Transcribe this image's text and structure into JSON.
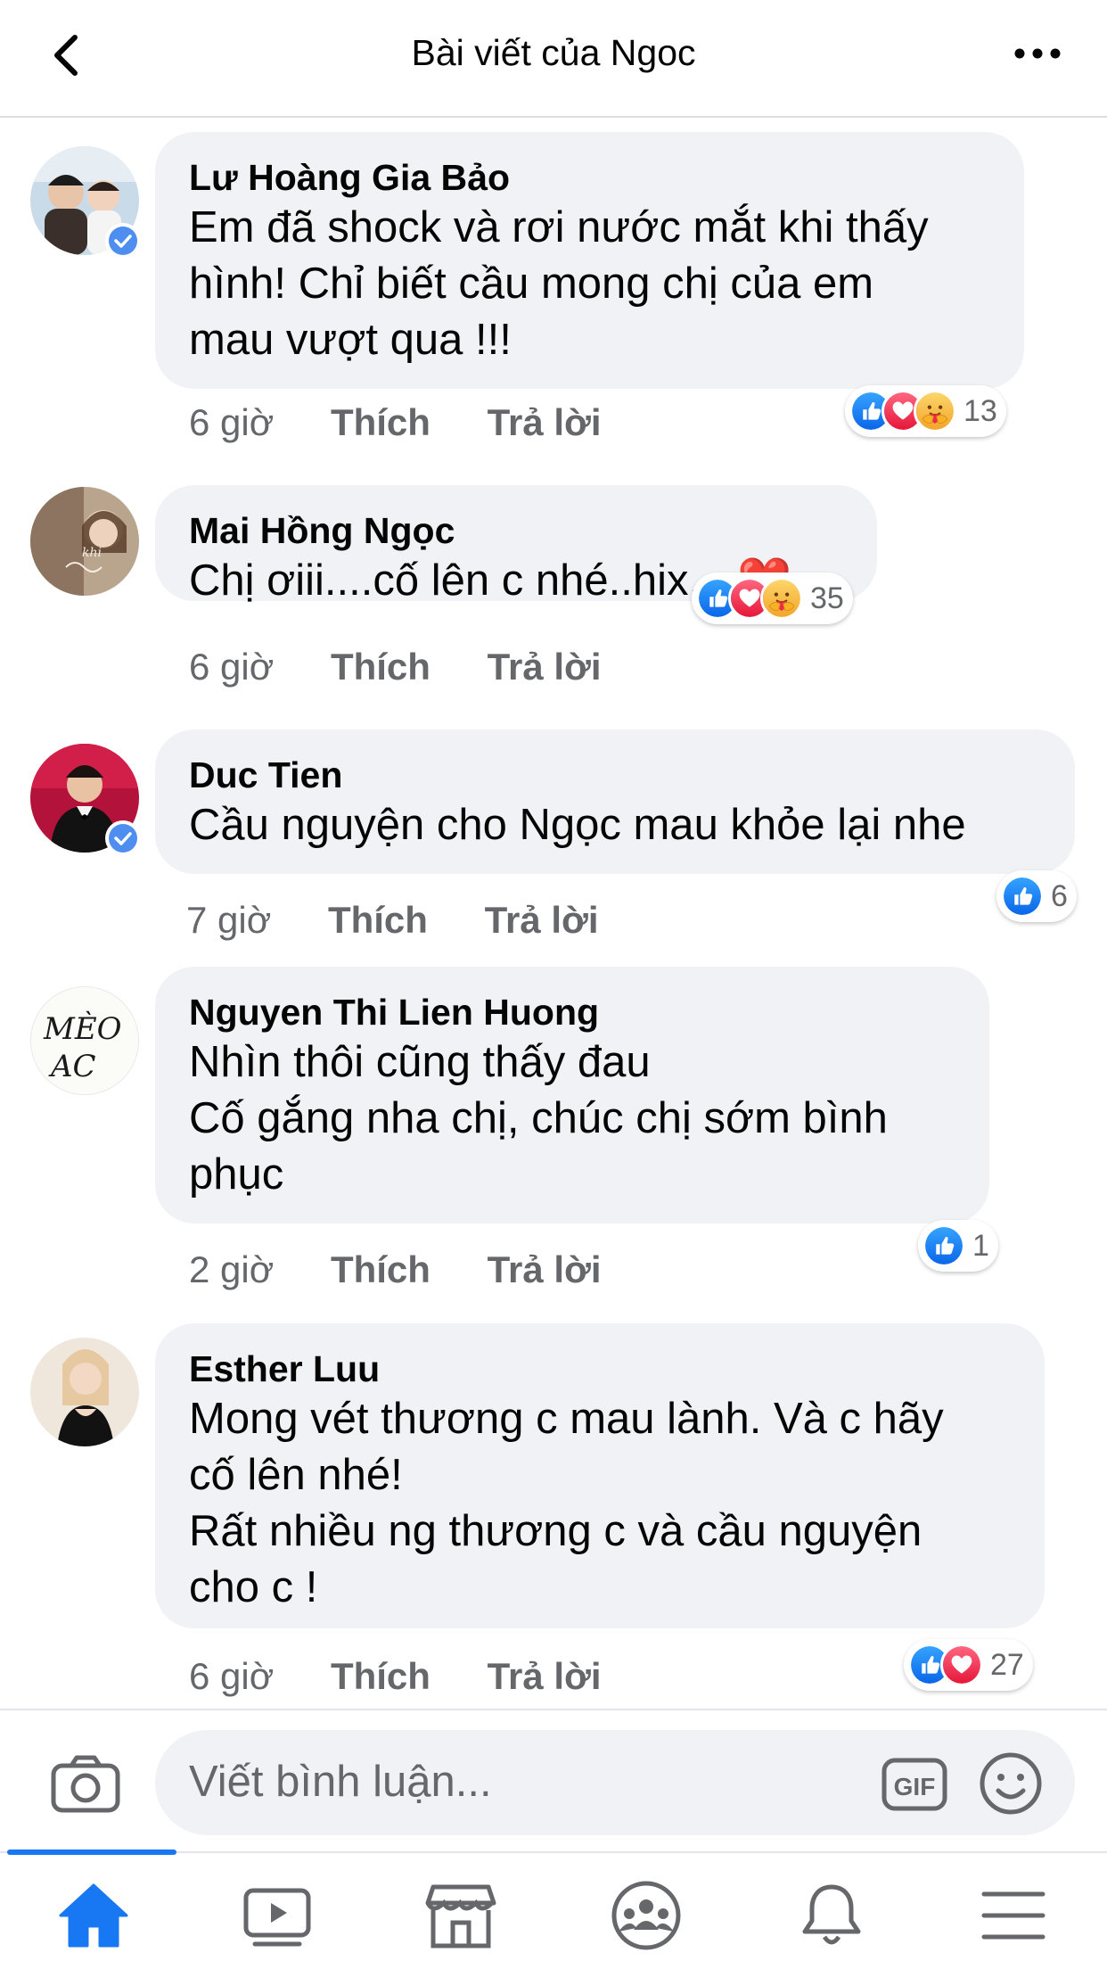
{
  "header": {
    "title": "Bài viết của Ngoc",
    "back_icon": "chevron-left-icon",
    "more_icon": "more-horizontal-icon"
  },
  "comments": [
    {
      "author": "Lư Hoàng Gia Bảo",
      "text": "Em đã shock và rơi nước mắt khi thấy\nhình! Chỉ biết cầu mong chị của em\nmau vượt qua !!!",
      "time": "6 giờ",
      "like": "Thích",
      "reply": "Trả lời",
      "reactions": [
        "like",
        "love",
        "care"
      ],
      "reaction_count": "13",
      "verified": true
    },
    {
      "author": "Mai Hồng Ngọc",
      "text": "Chị ơiii....cố lên c nhé..hix....❤️",
      "time": "6 giờ",
      "like": "Thích",
      "reply": "Trả lời",
      "reactions": [
        "like",
        "love",
        "care"
      ],
      "reaction_count": "35",
      "verified": false
    },
    {
      "author": "Duc Tien",
      "text": "Cầu nguyện cho Ngọc mau khỏe lại nhe",
      "time": "7 giờ",
      "like": "Thích",
      "reply": "Trả lời",
      "reactions": [
        "like"
      ],
      "reaction_count": "6",
      "verified": true
    },
    {
      "author": "Nguyen Thi Lien Huong",
      "text": "Nhìn thôi cũng thấy đau\nCố gắng nha chị, chúc chị sớm bình\nphục",
      "time": "2 giờ",
      "like": "Thích",
      "reply": "Trả lời",
      "reactions": [
        "like"
      ],
      "reaction_count": "1",
      "verified": false,
      "avatar_text_line1": "MÈO",
      "avatar_text_line2": "AC"
    },
    {
      "author": "Esther Luu",
      "text": "Mong vét thương c mau lành. Và c hãy\ncố lên nhé!\nRất nhiều ng thương c và cầu nguyện\ncho c !",
      "time": "6 giờ",
      "like": "Thích",
      "reply": "Trả lời",
      "reactions": [
        "like",
        "love"
      ],
      "reaction_count": "27",
      "verified": false
    }
  ],
  "write_bar": {
    "placeholder": "Viết bình luận...",
    "camera_icon": "camera-icon",
    "gif_label": "GIF",
    "emoji_icon": "smiley-icon"
  },
  "tabbar": {
    "active": "home",
    "tabs": [
      "home-icon",
      "video-icon",
      "marketplace-icon",
      "groups-icon",
      "bell-icon",
      "menu-icon"
    ]
  },
  "colors": {
    "accent": "#1877f2",
    "bubble": "#f0f2f5",
    "secondary_text": "#65676b",
    "love": "#f33e58",
    "care": "#f7b125"
  }
}
